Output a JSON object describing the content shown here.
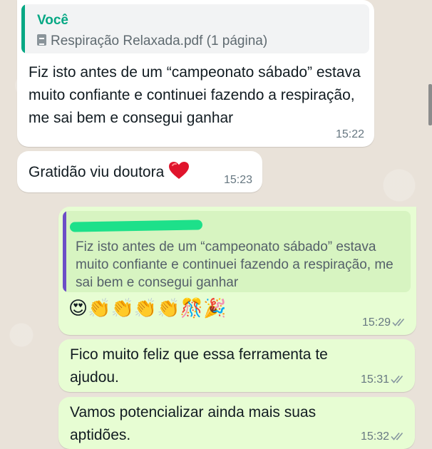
{
  "messages": [
    {
      "direction": "incoming",
      "reply_to": {
        "sender": "Você",
        "file": "Respiração Relaxada.pdf (1 página)",
        "file_icon": "document-icon"
      },
      "text": "Fiz isto antes de um “campeonato sábado” estava muito confiante e continuei fazendo a respiração, me sai bem e consegui ganhar",
      "time": "15:22"
    },
    {
      "direction": "incoming",
      "text": "Gratidão viu doutora",
      "emoji": "heart-icon",
      "time": "15:23"
    },
    {
      "direction": "outgoing",
      "reply_to": {
        "sender_redacted": true,
        "text": "Fiz isto antes de um “campeonato sábado” estava muito confiante e continuei fazendo a respiração, me sai bem e consegui ganhar"
      },
      "text": "😍👏👏👏👏🎊🎉",
      "time": "15:29",
      "status": "read"
    },
    {
      "direction": "outgoing",
      "text": "Fico muito feliz que essa ferramenta te ajudou.",
      "time": "15:31",
      "status": "read"
    },
    {
      "direction": "outgoing",
      "text": "Vamos potencializar ainda mais suas aptidões.",
      "time": "15:32",
      "status": "read"
    }
  ],
  "colors": {
    "incoming_bg": "#ffffff",
    "outgoing_bg": "#e7fdd3",
    "quote_self": "#06a884",
    "quote_other": "#6d4ec7",
    "redaction": "#1de08a",
    "heart": "#e0142c"
  }
}
